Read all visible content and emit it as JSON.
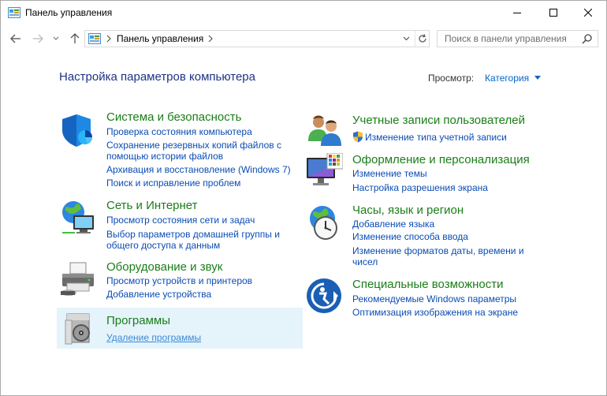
{
  "window": {
    "title": "Панель управления"
  },
  "address": {
    "path": "Панель управления",
    "search_placeholder": "Поиск в панели управления"
  },
  "header": {
    "title": "Настройка параметров компьютера",
    "view_label": "Просмотр:",
    "view_value": "Категория"
  },
  "left": [
    {
      "title": "Система и безопасность",
      "icon": "shield-icon",
      "links": [
        "Проверка состояния компьютера",
        "Сохранение резервных копий файлов с",
        "помощью истории файлов",
        "Архивация и восстановление (Windows 7)",
        "Поиск и исправление проблем"
      ]
    },
    {
      "title": "Сеть и Интернет",
      "icon": "network-globe-icon",
      "links": [
        "Просмотр состояния сети и задач",
        "Выбор параметров домашней группы и",
        "общего доступа к данным"
      ]
    },
    {
      "title": "Оборудование и звук",
      "icon": "printer-icon",
      "links": [
        "Просмотр устройств и принтеров",
        "Добавление устройства"
      ]
    },
    {
      "title": "Программы",
      "icon": "programs-disc-icon",
      "links": [
        "Удаление программы"
      ]
    }
  ],
  "right": [
    {
      "title": "Учетные записи пользователей",
      "icon": "users-icon",
      "links": [
        "Изменение типа учетной записи"
      ]
    },
    {
      "title": "Оформление и персонализация",
      "icon": "monitor-palette-icon",
      "links": [
        "Изменение темы",
        "Настройка разрешения экрана"
      ]
    },
    {
      "title": "Часы, язык и регион",
      "icon": "clock-globe-icon",
      "links": [
        "Добавление языка",
        "Изменение способа ввода",
        "Изменение форматов даты, времени и",
        "чисел"
      ]
    },
    {
      "title": "Специальные возможности",
      "icon": "accessibility-icon",
      "links": [
        "Рекомендуемые Windows параметры",
        "Оптимизация изображения на экране"
      ]
    }
  ],
  "colors": {
    "category_title": "#1a7e18",
    "link": "#0a4cb5",
    "page_title": "#1e3287",
    "highlight": "#e5f3fb"
  }
}
